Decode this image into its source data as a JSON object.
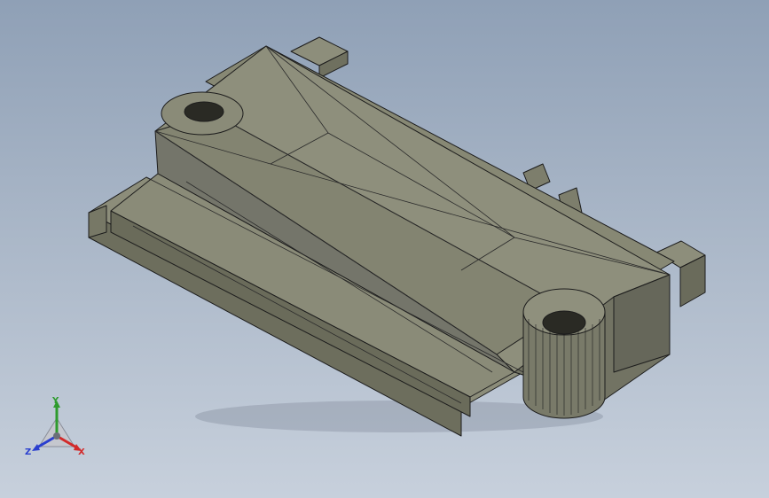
{
  "viewport": {
    "background_top": "#8fa0b6",
    "background_bottom": "#c7d0dc"
  },
  "model": {
    "face_color": "#8a8b78",
    "edge_color": "#1c1c1c",
    "shadow_color": "#6e7585"
  },
  "triad": {
    "y_label": "Y",
    "x_label": "X",
    "z_label": "Z",
    "y_color": "#2e9b2e",
    "x_color": "#d22a2a",
    "z_color": "#2a3fcf"
  }
}
